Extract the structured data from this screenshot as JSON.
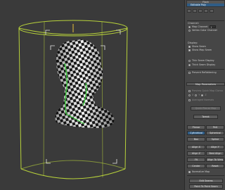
{
  "modifier_stack": {
    "items": [
      "Flock",
      "Editable Poly"
    ],
    "selected_index": 1
  },
  "channel_group": {
    "title": "Channel:",
    "map_channel_label": "Map Channel:",
    "map_channel_value": "1",
    "vertex_color_label": "Vertex Color Channel"
  },
  "display_group": {
    "title": "Display:",
    "options": [
      "Show Seam",
      "Show Map Seam",
      "Thin Seam Display",
      "Thick Seam Display"
    ],
    "checked": [
      true,
      true,
      false,
      true
    ]
  },
  "prevent_reflattening": "Prevent Reflattening",
  "map_parameters": {
    "title": "Map Parameters",
    "preview_label": "Preview Quick Map Gizmo",
    "axis_labels": [
      "X",
      "Y",
      "Z"
    ],
    "averaged_normals": "Averaged Normals",
    "quick_planar_map": "Quick Planar Map",
    "tweak": "Tweak",
    "buttons": [
      "Planar",
      "Pelt",
      "Cylindrical",
      "Spherical",
      "Box",
      "Spline",
      "Align X",
      "Align Y",
      "Align Z",
      "Best Align",
      "Fit",
      "Align To View",
      "Center",
      "Reset"
    ],
    "active_button": "Cylindrical",
    "normalize_map": "Normalize Map"
  },
  "edit_seams_button": "Edit Seams",
  "point_to_point_seams_button": "Point To Point Seam"
}
